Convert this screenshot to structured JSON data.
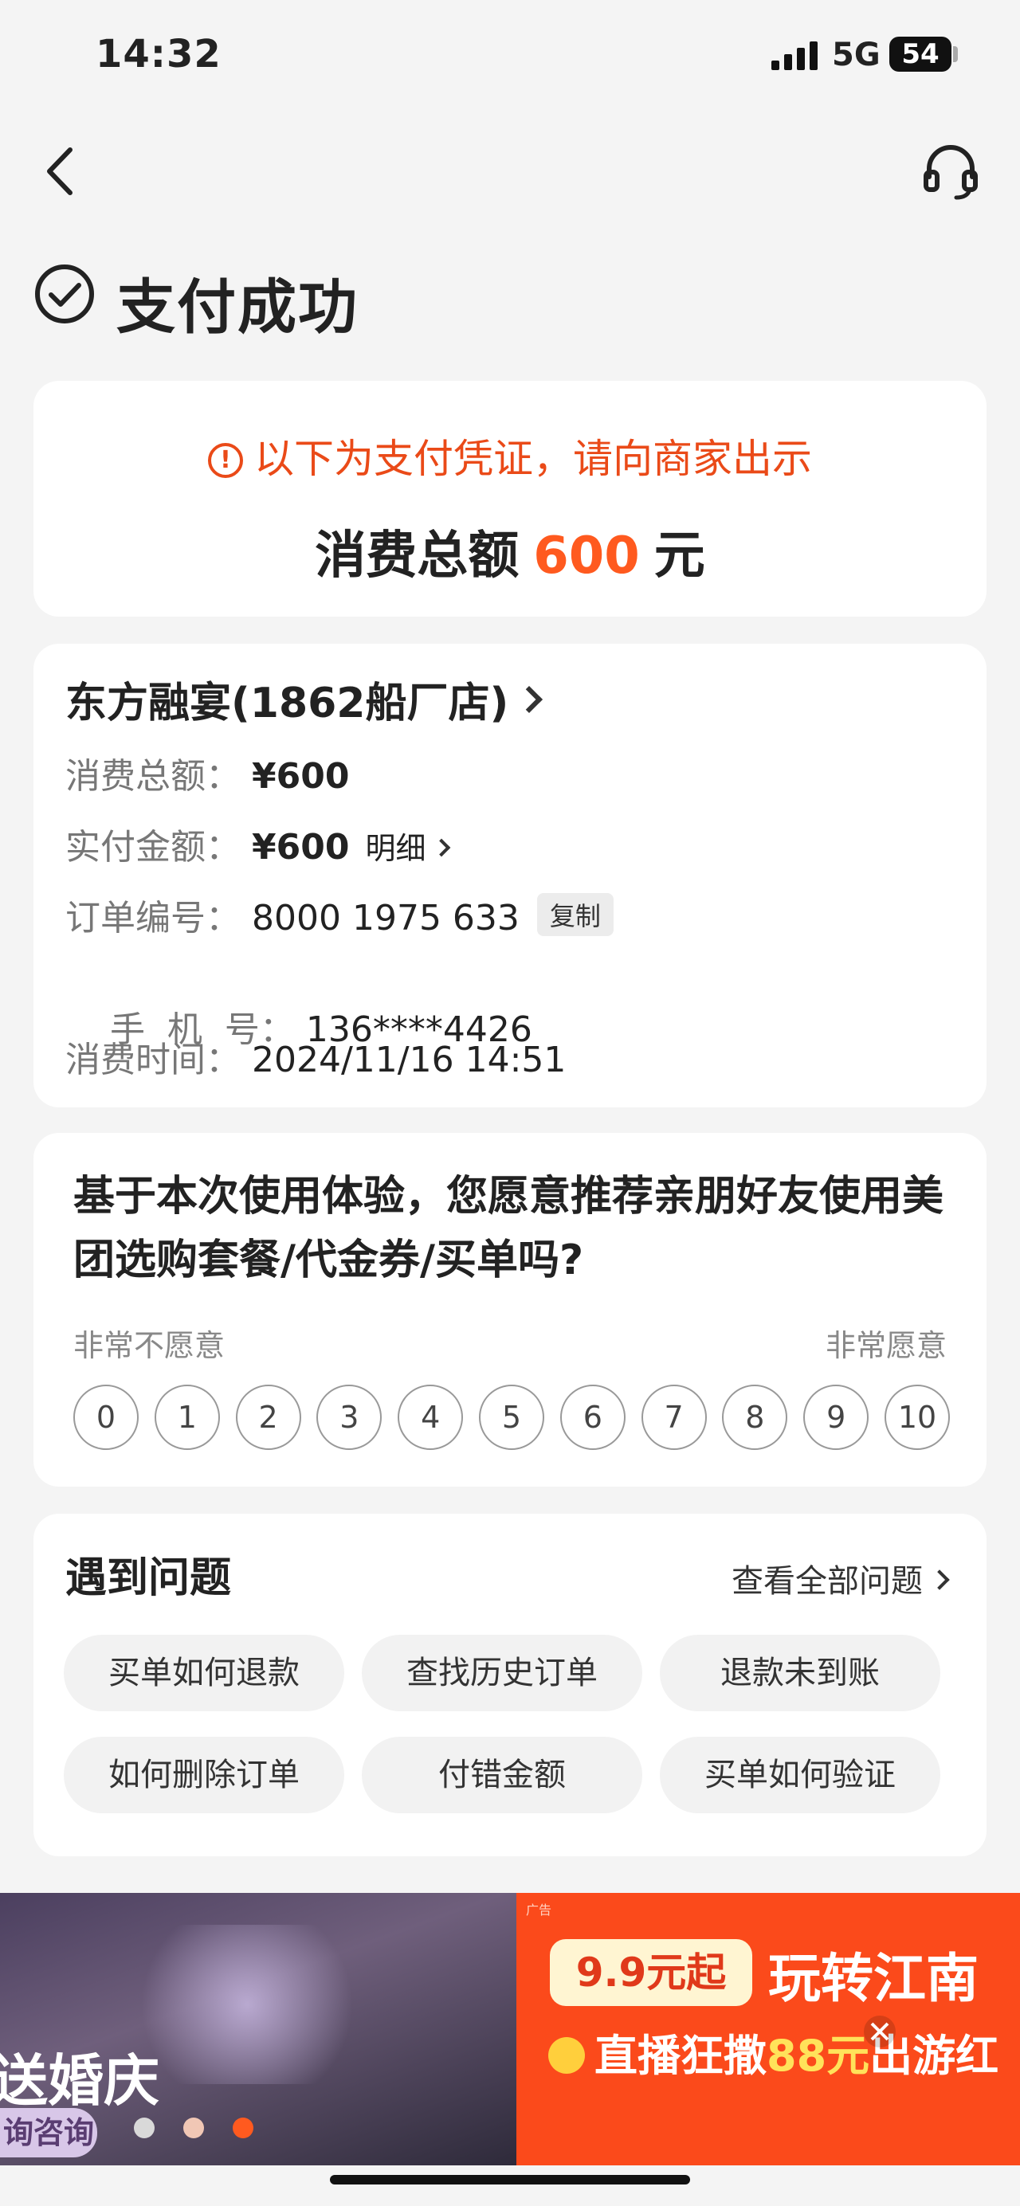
{
  "status_bar": {
    "time": "14:32",
    "network": "5G",
    "battery": "54"
  },
  "header": {
    "title": "支付成功"
  },
  "voucher": {
    "notice": "以下为支付凭证，请向商家出示",
    "total_prefix": "消费总额",
    "total_value": "600",
    "total_unit": "元"
  },
  "order": {
    "shop_name": "东方融宴(1862船厂店)",
    "rows": [
      {
        "label": "消费总额：",
        "value": "¥600"
      },
      {
        "label": "实付金额：",
        "value": "¥600",
        "extra": "明细"
      },
      {
        "label": "订单编号：",
        "value": "8000 1975 633",
        "extra": "复制"
      },
      {
        "label": "手  机  号：",
        "value": "136****4426"
      },
      {
        "label": "消费时间：",
        "value": "2024/11/16 14:51"
      }
    ]
  },
  "survey": {
    "question": "基于本次使用体验，您愿意推荐亲朋好友使用美团选购套餐/代金券/买单吗?",
    "left_label": "非常不愿意",
    "right_label": "非常愿意",
    "scores": [
      "0",
      "1",
      "2",
      "3",
      "4",
      "5",
      "6",
      "7",
      "8",
      "9",
      "10"
    ]
  },
  "problems": {
    "title": "遇到问题",
    "view_all": "查看全部问题",
    "chips": [
      "买单如何退款",
      "查找历史订单",
      "退款未到账",
      "如何删除订单",
      "付错金额",
      "买单如何验证"
    ]
  },
  "ad": {
    "left_text": "送婚庆",
    "left_button": "询咨询",
    "tag": "广告",
    "price": "9.9元起",
    "slogan": "玩转江南",
    "sub_a": "直播狂撒",
    "sub_b": "88元",
    "sub_c": "出游红"
  },
  "icons": [
    "signal-icon",
    "battery-icon",
    "back-icon",
    "headset-icon",
    "check-circle-icon",
    "alert-icon",
    "chevron-right-icon",
    "close-icon"
  ],
  "colors": {
    "accent": "#ff5a1f",
    "notice": "#ea4a18",
    "ad_bg": "#fb4a1b"
  }
}
